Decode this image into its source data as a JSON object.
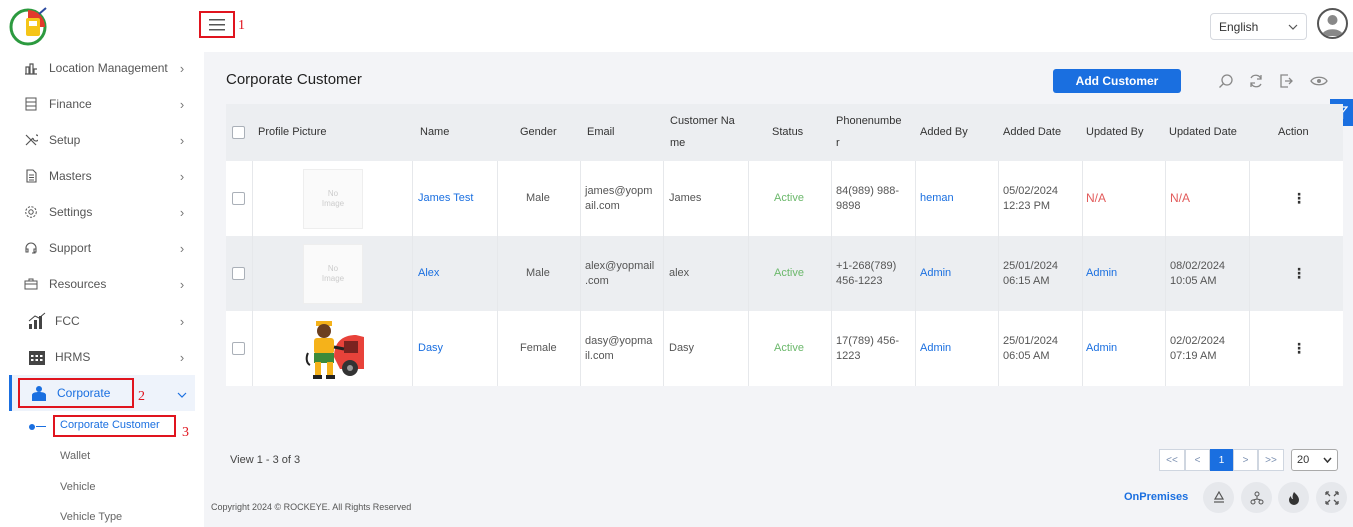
{
  "header": {
    "language": "English",
    "annotations": {
      "a1": "1",
      "a2": "2",
      "a3": "3"
    }
  },
  "sidebar": {
    "items": [
      {
        "label": "Location Management",
        "icon": "chart-icon"
      },
      {
        "label": "Finance",
        "icon": "finance-icon"
      },
      {
        "label": "Setup",
        "icon": "tools-icon"
      },
      {
        "label": "Masters",
        "icon": "document-icon"
      },
      {
        "label": "Settings",
        "icon": "gear-icon"
      },
      {
        "label": "Support",
        "icon": "headset-icon"
      },
      {
        "label": "Resources",
        "icon": "briefcase-icon"
      },
      {
        "label": "FCC",
        "icon": "bar-chart-icon"
      },
      {
        "label": "HRMS",
        "icon": "calendar-icon"
      },
      {
        "label": "Corporate",
        "icon": "corporate-user-icon"
      }
    ],
    "sub_items": [
      "Corporate Customer",
      "Wallet",
      "Vehicle",
      "Vehicle Type"
    ]
  },
  "main": {
    "title": "Corporate Customer",
    "add_button": "Add Customer",
    "columns": [
      "Profile Picture",
      "Name",
      "Gender",
      "Email",
      "Customer Na",
      "me",
      "Status",
      "Phonenumbe",
      "r",
      "Added By",
      "Added Date",
      "Updated By",
      "Updated Date",
      "Action"
    ],
    "no_image": [
      "No",
      "Image"
    ],
    "rows": [
      {
        "name": "James Test",
        "gender": "Male",
        "email": [
          "james@yopm",
          "ail.com"
        ],
        "customer_name": "James",
        "status": "Active",
        "phone": [
          "84(989) 988-",
          "9898"
        ],
        "added_by": "heman",
        "added_date": [
          "05/02/2024",
          "12:23 PM"
        ],
        "updated_by": "N/A",
        "updated_date": "N/A"
      },
      {
        "name": "Alex",
        "gender": "Male",
        "email": [
          "alex@yopmail",
          ".com"
        ],
        "customer_name": "alex",
        "status": "Active",
        "phone": [
          "+1-268(789)",
          "456-1223"
        ],
        "added_by": "Admin",
        "added_date": [
          "25/01/2024",
          "06:15 AM"
        ],
        "updated_by": "Admin",
        "updated_date": [
          "08/02/2024",
          "10:05 AM"
        ]
      },
      {
        "name": "Dasy",
        "gender": "Female",
        "email": [
          "dasy@yopma",
          "il.com"
        ],
        "customer_name": "Dasy",
        "status": "Active",
        "phone": [
          "17(789) 456-",
          "1223"
        ],
        "added_by": "Admin",
        "added_date": [
          "25/01/2024",
          "06:05 AM"
        ],
        "updated_by": "Admin",
        "updated_date": [
          "02/02/2024",
          "07:19 AM"
        ]
      }
    ],
    "view_info": "View 1 - 3 of 3",
    "pagination": {
      "first": "<<",
      "prev": "<",
      "current": "1",
      "next": ">",
      "last": ">>",
      "page_size": "20"
    }
  },
  "footer": {
    "copyright": "Copyright 2024 © ROCKEYE. All Rights Reserved",
    "onpremises": "OnPremises"
  },
  "colors": {
    "accent": "#1a6fe0",
    "annotation": "#e0141e",
    "active_status": "#6bb86b",
    "na": "#e25b5b"
  }
}
